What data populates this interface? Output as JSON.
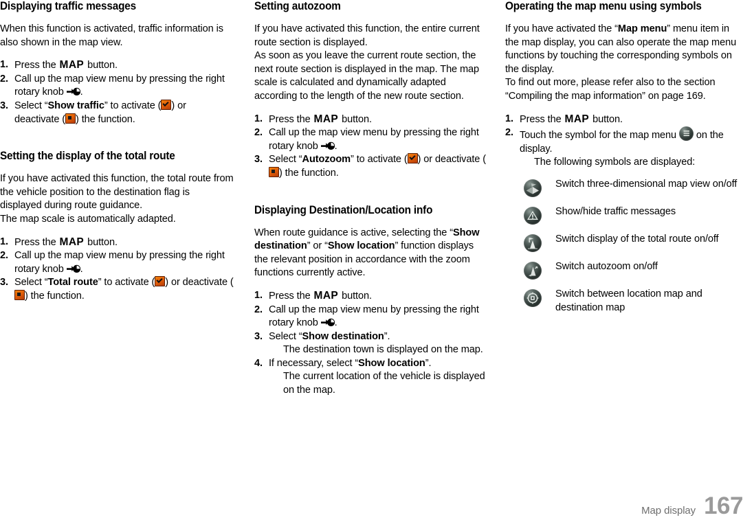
{
  "document": {
    "type": "vehicle-owner-manual-page",
    "footer": {
      "chapter_label": "Map display",
      "page_number": "167"
    }
  },
  "columns": [
    {
      "id": "column-1",
      "sections": [
        {
          "id": "displaying-traffic-messages",
          "title": "Displaying traffic messages",
          "paragraphs": [
            "When this function is activated, traffic information is also shown in the map view."
          ],
          "steps": [
            {
              "num": "1.",
              "parts": [
                {
                  "t": "text",
                  "v": "Press the "
                },
                {
                  "t": "mapbtn",
                  "v": "MAP"
                },
                {
                  "t": "text",
                  "v": " button."
                }
              ]
            },
            {
              "num": "2.",
              "parts": [
                {
                  "t": "text",
                  "v": "Call up the map view menu by pressing the right rotary knob "
                },
                {
                  "t": "icon",
                  "v": "rotary-knob-icon"
                },
                {
                  "t": "text",
                  "v": "."
                }
              ]
            },
            {
              "num": "3.",
              "parts": [
                {
                  "t": "text",
                  "v": "Select “"
                },
                {
                  "t": "bold",
                  "v": "Show traffic"
                },
                {
                  "t": "text",
                  "v": "” to activate ("
                },
                {
                  "t": "icon",
                  "v": "checkbox-checked-icon"
                },
                {
                  "t": "text",
                  "v": ") or deactivate ("
                },
                {
                  "t": "icon",
                  "v": "checkbox-unchecked-icon"
                },
                {
                  "t": "text",
                  "v": ") the function."
                }
              ]
            }
          ]
        },
        {
          "id": "setting-the-display-of-the-total-route",
          "title": "Setting the display of the total route",
          "paragraphs": [
            "If you have activated this function, the total route from the vehicle position to the destination flag is displayed during route guidance.",
            "The map scale is automatically adapted."
          ],
          "steps": [
            {
              "num": "1.",
              "parts": [
                {
                  "t": "text",
                  "v": "Press the "
                },
                {
                  "t": "mapbtn",
                  "v": "MAP"
                },
                {
                  "t": "text",
                  "v": " button."
                }
              ]
            },
            {
              "num": "2.",
              "parts": [
                {
                  "t": "text",
                  "v": "Call up the map view menu by pressing the right rotary knob "
                },
                {
                  "t": "icon",
                  "v": "rotary-knob-icon"
                },
                {
                  "t": "text",
                  "v": "."
                }
              ]
            },
            {
              "num": "3.",
              "parts": [
                {
                  "t": "text",
                  "v": "Select “"
                },
                {
                  "t": "bold",
                  "v": "Total route"
                },
                {
                  "t": "text",
                  "v": "” to activate ("
                },
                {
                  "t": "icon",
                  "v": "checkbox-checked-icon"
                },
                {
                  "t": "text",
                  "v": ") or deactivate ("
                },
                {
                  "t": "icon",
                  "v": "checkbox-unchecked-icon"
                },
                {
                  "t": "text",
                  "v": ") the function."
                }
              ]
            }
          ]
        }
      ]
    },
    {
      "id": "column-2",
      "sections": [
        {
          "id": "setting-autozoom",
          "title": "Setting autozoom",
          "paragraphs": [
            "If you have activated this function, the entire current route section is displayed.",
            "As soon as you leave the current route section, the next route section is displayed in the map. The map scale is calculated and dynamically adapted according to the length of the new route section."
          ],
          "steps": [
            {
              "num": "1.",
              "parts": [
                {
                  "t": "text",
                  "v": "Press the "
                },
                {
                  "t": "mapbtn",
                  "v": "MAP"
                },
                {
                  "t": "text",
                  "v": " button."
                }
              ]
            },
            {
              "num": "2.",
              "parts": [
                {
                  "t": "text",
                  "v": "Call up the map view menu by pressing the right rotary knob "
                },
                {
                  "t": "icon",
                  "v": "rotary-knob-icon"
                },
                {
                  "t": "text",
                  "v": "."
                }
              ]
            },
            {
              "num": "3.",
              "parts": [
                {
                  "t": "text",
                  "v": "Select “"
                },
                {
                  "t": "bold",
                  "v": "Autozoom"
                },
                {
                  "t": "text",
                  "v": "” to activate ("
                },
                {
                  "t": "icon",
                  "v": "checkbox-checked-icon"
                },
                {
                  "t": "text",
                  "v": ") or deactivate ("
                },
                {
                  "t": "icon",
                  "v": "checkbox-unchecked-icon"
                },
                {
                  "t": "text",
                  "v": ") the function."
                }
              ]
            }
          ]
        },
        {
          "id": "displaying-destination-location-info",
          "title": "Displaying Destination/Location info",
          "paragraphs_rich": [
            [
              {
                "t": "text",
                "v": "When route guidance is active, selecting the “"
              },
              {
                "t": "bold",
                "v": "Show destination"
              },
              {
                "t": "text",
                "v": "” or “"
              },
              {
                "t": "bold",
                "v": "Show location"
              },
              {
                "t": "text",
                "v": "” function displays the relevant position in accordance with the zoom functions currently active."
              }
            ]
          ],
          "steps": [
            {
              "num": "1.",
              "parts": [
                {
                  "t": "text",
                  "v": "Press the "
                },
                {
                  "t": "mapbtn",
                  "v": "MAP"
                },
                {
                  "t": "text",
                  "v": " button."
                }
              ]
            },
            {
              "num": "2.",
              "parts": [
                {
                  "t": "text",
                  "v": "Call up the map view menu by pressing the right rotary knob "
                },
                {
                  "t": "icon",
                  "v": "rotary-knob-icon"
                },
                {
                  "t": "text",
                  "v": "."
                }
              ]
            },
            {
              "num": "3.",
              "parts": [
                {
                  "t": "text",
                  "v": "Select “"
                },
                {
                  "t": "bold",
                  "v": "Show destination"
                },
                {
                  "t": "text",
                  "v": "”."
                },
                {
                  "t": "break",
                  "v": ""
                },
                {
                  "t": "text",
                  "v": "The destination town is displayed on the map."
                }
              ]
            },
            {
              "num": "4.",
              "parts": [
                {
                  "t": "text",
                  "v": "If necessary, select “"
                },
                {
                  "t": "bold",
                  "v": "Show location"
                },
                {
                  "t": "text",
                  "v": "”."
                },
                {
                  "t": "break",
                  "v": ""
                },
                {
                  "t": "text",
                  "v": "The current location of the vehicle is displayed on the map."
                }
              ]
            }
          ]
        }
      ]
    },
    {
      "id": "column-3",
      "sections": [
        {
          "id": "operating-the-map-menu-using-symbols",
          "title": "Operating the map menu using symbols",
          "paragraphs_rich": [
            [
              {
                "t": "text",
                "v": "If you have activated the “"
              },
              {
                "t": "bold",
                "v": "Map menu"
              },
              {
                "t": "text",
                "v": "” menu item in the map display, you can also operate the map menu functions by touching the corresponding symbols on the display."
              }
            ],
            [
              {
                "t": "text",
                "v": "To find out more, please refer also to the section “Compiling the map information” on page 169."
              }
            ]
          ],
          "steps": [
            {
              "num": "1.",
              "parts": [
                {
                  "t": "text",
                  "v": "Press the "
                },
                {
                  "t": "mapbtn",
                  "v": "MAP"
                },
                {
                  "t": "text",
                  "v": " button."
                }
              ]
            },
            {
              "num": "2.",
              "parts": [
                {
                  "t": "text",
                  "v": "Touch the symbol for the map menu "
                },
                {
                  "t": "icon",
                  "v": "map-menu-symbol-icon"
                },
                {
                  "t": "text",
                  "v": " on the display."
                },
                {
                  "t": "break",
                  "v": ""
                },
                {
                  "t": "text",
                  "v": "The following symbols are displayed:"
                }
              ]
            }
          ],
          "symbol_legend": [
            {
              "icon": "three-dimensional-map-view-icon",
              "label": "Switch three-dimensional map view on/off"
            },
            {
              "icon": "traffic-messages-icon",
              "label": "Show/hide traffic messages"
            },
            {
              "icon": "total-route-display-icon",
              "label": "Switch display of the total route on/off"
            },
            {
              "icon": "autozoom-icon",
              "label": "Switch autozoom on/off"
            },
            {
              "icon": "location-destination-map-icon",
              "label": "Switch between location map and destination map"
            }
          ]
        }
      ]
    }
  ],
  "colors": {
    "text": "#000000",
    "checkbox_orange": "#e2600a",
    "checkbox_border": "#5c1d02",
    "symbol_button_dark": "#2d3734",
    "footer_label": "#6e6e6e",
    "footer_page": "#9a9a9a"
  }
}
